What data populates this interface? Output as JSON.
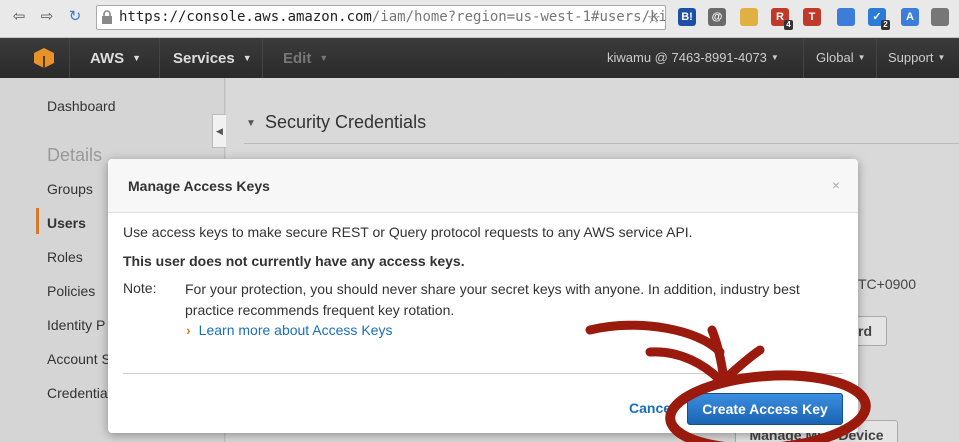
{
  "browser": {
    "url_main": "https://console.aws.amazon.com",
    "url_rest": "/iam/home?region=us-west-1#users/ki",
    "extensions": [
      {
        "name": "hatena-bookmark-icon",
        "text": "B!",
        "color": "#1e4fa8"
      },
      {
        "name": "mail-icon",
        "text": "@",
        "color": "#6a6a6a"
      },
      {
        "name": "cat-icon",
        "text": "",
        "color": "#e0b040"
      },
      {
        "name": "reader-icon",
        "text": "R",
        "color": "#c0392b",
        "badge": "4"
      },
      {
        "name": "translate-t-icon",
        "text": "T",
        "color": "#c0392b"
      },
      {
        "name": "chat-icon",
        "text": "",
        "color": "#3b7dd8"
      },
      {
        "name": "task-icon",
        "text": "✓",
        "color": "#2b7bd8",
        "badge": "2"
      },
      {
        "name": "google-translate-icon",
        "text": "A",
        "color": "#3b7dd8"
      },
      {
        "name": "cast-icon",
        "text": "",
        "color": "#777777"
      }
    ]
  },
  "aws_bar": {
    "brand": "AWS",
    "services": "Services",
    "edit": "Edit",
    "account": "kiwamu @ 7463-8991-4073",
    "region": "Global",
    "support": "Support"
  },
  "sidebar": {
    "items": [
      {
        "label": "Dashboard"
      },
      {
        "label": "Details"
      },
      {
        "label": "Groups"
      },
      {
        "label": "Users"
      },
      {
        "label": "Roles"
      },
      {
        "label": "Policies"
      },
      {
        "label": "Identity P"
      },
      {
        "label": "Account S"
      },
      {
        "label": "Credential"
      }
    ]
  },
  "main": {
    "section_title": "Security Credentials",
    "partial_tz": "TC+0900",
    "partial_button": "rd",
    "partial_mfa": "Manage MFA Device"
  },
  "modal": {
    "title": "Manage Access Keys",
    "close": "×",
    "intro": "Use access keys to make secure REST or Query protocol requests to any AWS service API.",
    "no_keys": "This user does not currently have any access keys.",
    "note_label": "Note:",
    "note_body": "For your protection, you should never share your secret keys with anyone. In addition, industry best practice recommends frequent key rotation.",
    "learn_more": "Learn more about Access Keys",
    "cancel": "Cancel",
    "create": "Create Access Key"
  }
}
